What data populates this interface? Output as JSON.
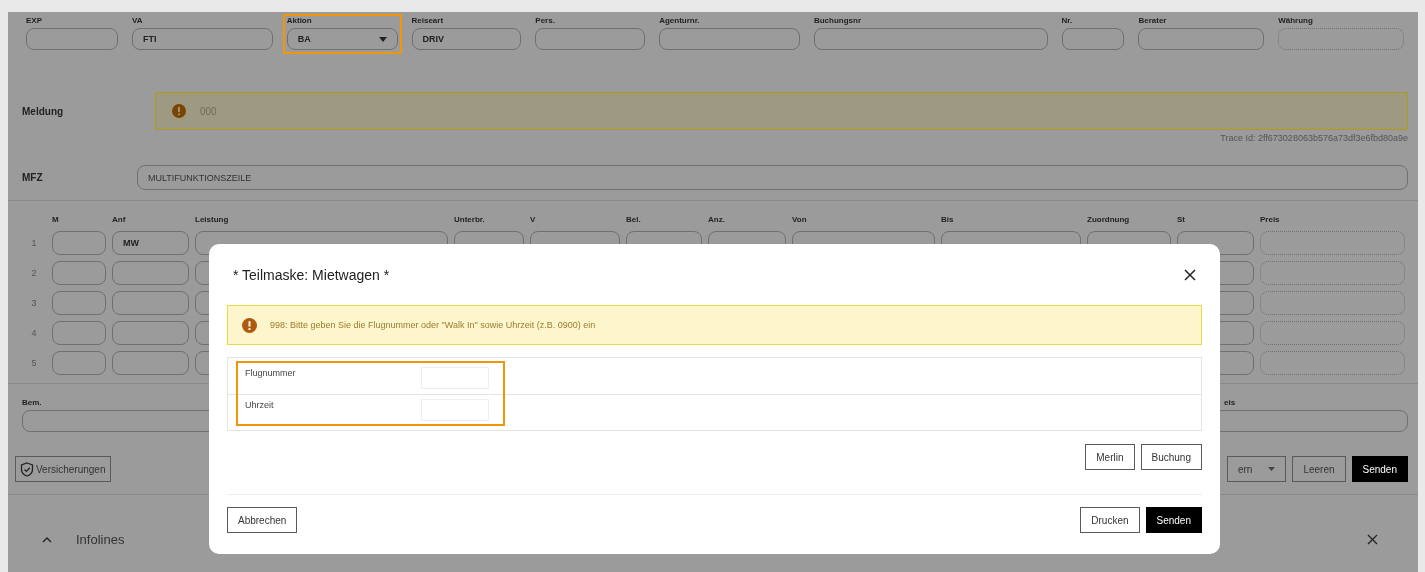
{
  "header_fields": [
    {
      "label": "EXP",
      "kind": "input",
      "highlighted": false
    },
    {
      "label": "VA",
      "kind": "input",
      "value": "FTI",
      "highlighted": false
    },
    {
      "label": "Aktion",
      "kind": "select",
      "value": "BA",
      "highlighted": true
    },
    {
      "label": "Reiseart",
      "kind": "input",
      "value": "DRIV",
      "highlighted": false
    },
    {
      "label": "Pers.",
      "kind": "input",
      "highlighted": false
    },
    {
      "label": "Agenturnr.",
      "kind": "input",
      "highlighted": false
    },
    {
      "label": "Buchungsnr",
      "kind": "input",
      "highlighted": false
    },
    {
      "label": "Nr.",
      "kind": "input",
      "highlighted": false
    },
    {
      "label": "Berater",
      "kind": "input",
      "highlighted": false
    },
    {
      "label": "Währung",
      "kind": "dotted",
      "highlighted": false
    }
  ],
  "message": {
    "label": "Meldung",
    "code": "000",
    "trace": "Trace Id: 2ff673028063b576a73df3e6fbd80a9e"
  },
  "mfz": {
    "label": "MFZ",
    "value": "MULTIFUNKTIONSZEILE"
  },
  "service_table": {
    "columns": [
      {
        "label": "M",
        "kind": "input"
      },
      {
        "label": "Anf",
        "kind": "input"
      },
      {
        "label": "Leistung",
        "kind": "input"
      },
      {
        "label": "Unterbr.",
        "kind": "input"
      },
      {
        "label": "V",
        "kind": "input"
      },
      {
        "label": "Bel.",
        "kind": "input"
      },
      {
        "label": "Anz.",
        "kind": "input"
      },
      {
        "label": "Von",
        "kind": "input"
      },
      {
        "label": "Bis",
        "kind": "input"
      },
      {
        "label": "Zuordnung",
        "kind": "input"
      },
      {
        "label": "St",
        "kind": "input"
      },
      {
        "label": "Preis",
        "kind": "dotted"
      }
    ],
    "rows": [
      {
        "number": "1",
        "values": {
          "1": "MW"
        }
      },
      {
        "number": "2",
        "values": {}
      },
      {
        "number": "3",
        "values": {}
      },
      {
        "number": "4",
        "values": {}
      },
      {
        "number": "5",
        "values": {}
      }
    ]
  },
  "remarks": {
    "label": "Bem.",
    "price_label": "eis"
  },
  "actions": {
    "insurance": "Versicherungen",
    "dropdown": "ern",
    "buttons": [
      {
        "label": "Leeren",
        "primary": false
      },
      {
        "label": "Senden",
        "primary": true
      }
    ]
  },
  "infolines": {
    "title": "Infolines"
  },
  "dialog": {
    "title": "* Teilmaske: Mietwagen *",
    "warning": "998: Bitte geben Sie die Flugnummer oder \"Walk In\" sowie Uhrzeit (z.B. 0900) ein",
    "fields_highlighted": true,
    "fields": [
      {
        "label": "Flugnummer"
      },
      {
        "label": "Uhrzeit"
      }
    ],
    "side_buttons": [
      "Merlin",
      "Buchung"
    ],
    "cancel": "Abbrechen",
    "footer_buttons": [
      {
        "label": "Drucken",
        "primary": false
      },
      {
        "label": "Senden",
        "primary": true
      }
    ]
  }
}
